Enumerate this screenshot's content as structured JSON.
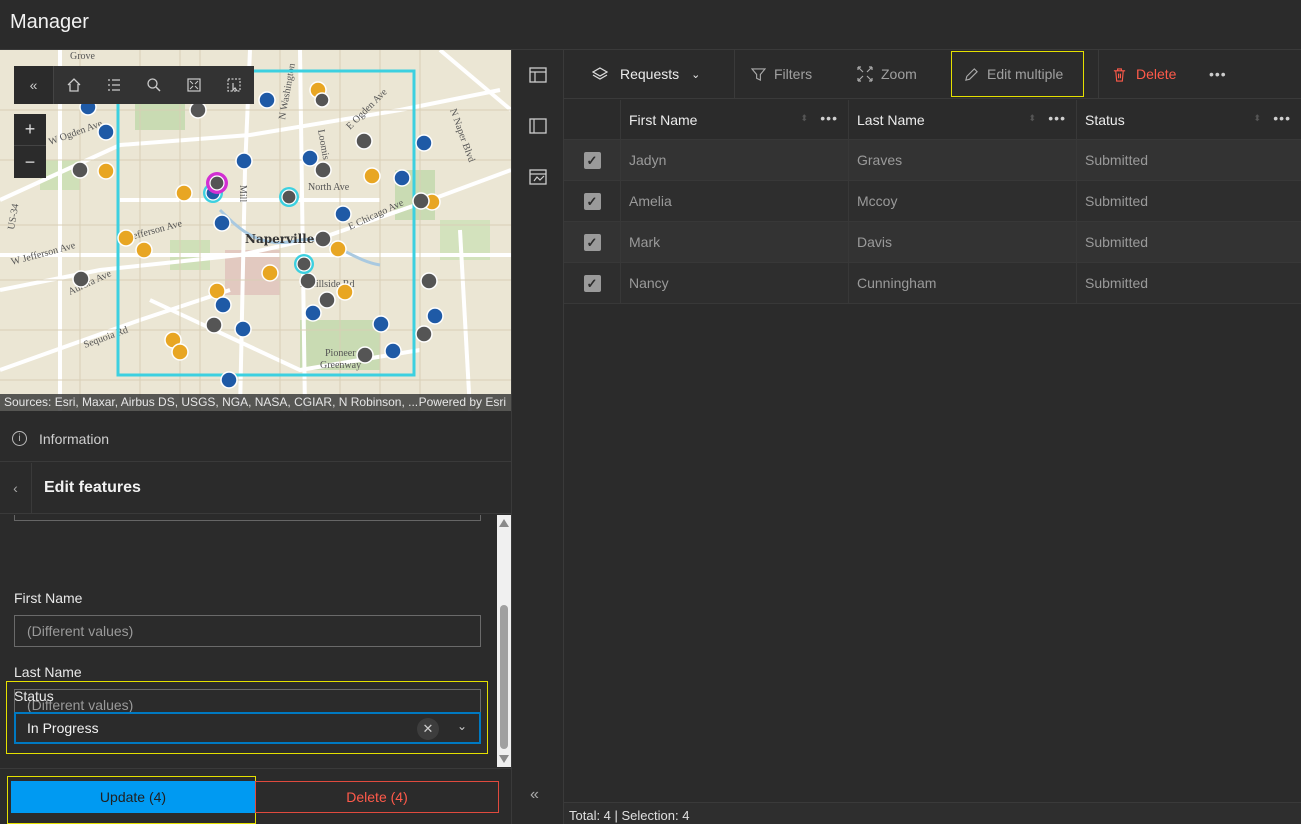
{
  "app": {
    "title": "Manager"
  },
  "map": {
    "attribution_left": "Sources: Esri, Maxar, Airbus DS, USGS, NGA, NASA, CGIAR, N Robinson, ...",
    "attribution_right": "Powered by Esri",
    "labels": [
      "Grove",
      "W Ogden Ave",
      "US-34",
      "Jefferson Ave",
      "W Jefferson Ave",
      "Aurora Ave",
      "Sequoia Rd",
      "Naperville",
      "North Ave",
      "E Chicago Ave",
      "E Hillside Rd",
      "Pioneer Greenway",
      "E Ogden Ave",
      "N Naper Blvd",
      "N Washington",
      "Loomis",
      "Mill"
    ],
    "toolbar": [
      "home-icon",
      "list-icon",
      "search-icon",
      "fullscreen-icon",
      "select-icon"
    ]
  },
  "info": {
    "label": "Information"
  },
  "edit": {
    "title": "Edit features",
    "fields": {
      "first_name_label": "First Name",
      "first_name_placeholder": "(Different values)",
      "last_name_label": "Last Name",
      "last_name_placeholder": "(Different values)",
      "status_label": "Status",
      "status_value": "In Progress"
    },
    "update_label": "Update (4)",
    "delete_label": "Delete (4)"
  },
  "table_panel": {
    "toolbar": {
      "layer": "Requests",
      "filters": "Filters",
      "zoom": "Zoom",
      "edit_multiple": "Edit multiple",
      "delete": "Delete"
    },
    "columns": [
      "First Name",
      "Last Name",
      "Status"
    ],
    "rows": [
      {
        "first": "Jadyn",
        "last": "Graves",
        "status": "Submitted"
      },
      {
        "first": "Amelia",
        "last": "Mccoy",
        "status": "Submitted"
      },
      {
        "first": "Mark",
        "last": "Davis",
        "status": "Submitted"
      },
      {
        "first": "Nancy",
        "last": "Cunningham",
        "status": "Submitted"
      }
    ],
    "footer": "Total: 4 | Selection: 4"
  },
  "colors": {
    "accent": "#009af2",
    "danger": "#ff5a4a",
    "highlight": "#e5e000",
    "selection": "#3cd0e0"
  }
}
